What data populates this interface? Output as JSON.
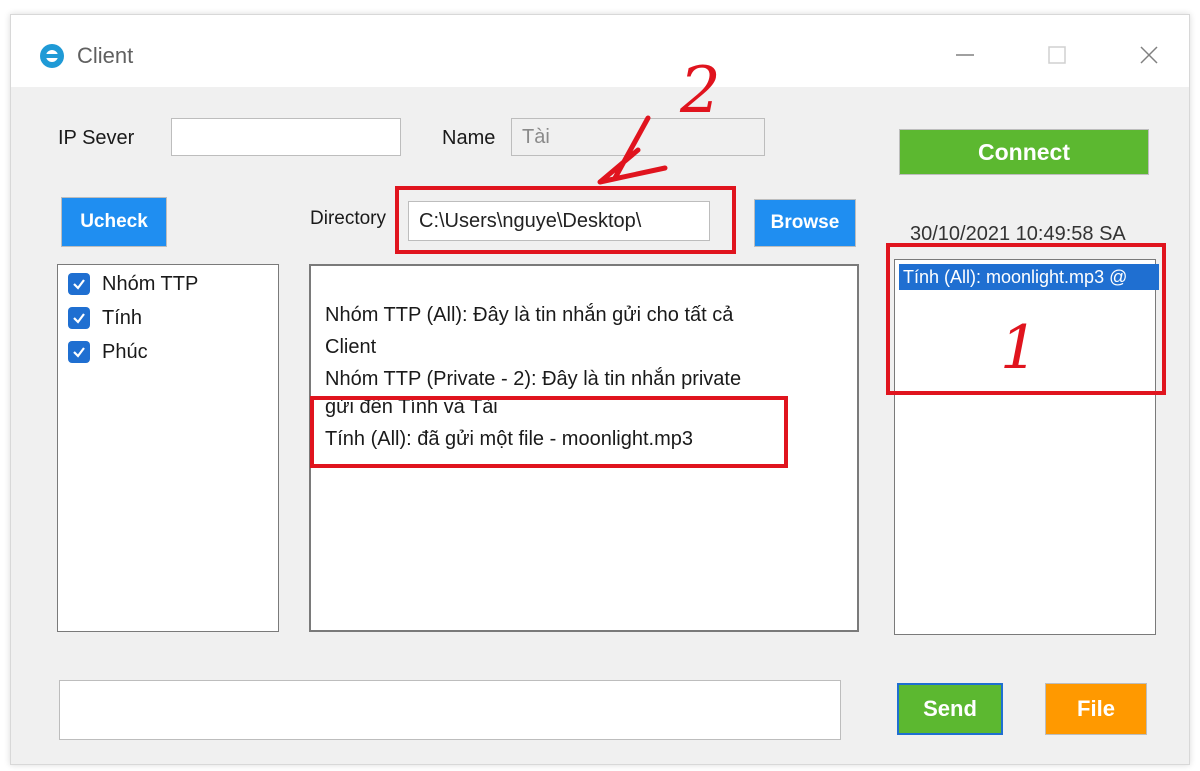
{
  "window": {
    "title": "Client",
    "minimize_glyph": "—",
    "maximize_glyph": "☐",
    "close_glyph": "✕"
  },
  "connection": {
    "ip_label": "IP Sever",
    "ip_value": "",
    "name_label": "Name",
    "name_value": "Tài",
    "connect_label": "Connect"
  },
  "toolbar": {
    "uncheck_label": "Ucheck",
    "directory_label": "Directory",
    "directory_value": "C:\\Users\\nguye\\Desktop\\",
    "browse_label": "Browse",
    "timestamp": "30/10/2021 10:49:58 SA"
  },
  "members": [
    {
      "label": "Nhóm TTP",
      "checked": true
    },
    {
      "label": "Tính",
      "checked": true
    },
    {
      "label": "Phúc",
      "checked": true
    }
  ],
  "chat": {
    "lines": [
      "Nhóm TTP (All): Đây là tin nhắn gửi cho tất cả",
      "Client",
      "Nhóm TTP (Private - 2): Đây là tin nhắn private",
      "gửi đến Tính và Tài",
      "Tính (All): đã gửi một file - moonlight.mp3"
    ]
  },
  "files": {
    "selected_item": "Tính (All): moonlight.mp3 @"
  },
  "composer": {
    "message_value": "",
    "send_label": "Send",
    "file_label": "File"
  },
  "annotations": {
    "label_1": "1",
    "label_2": "2",
    "color": "#e0141e"
  },
  "colors": {
    "accent_blue": "#1f8ef1",
    "connect_green": "#5cb830",
    "file_orange": "#ff9900",
    "selection_blue": "#1f6fd1"
  }
}
